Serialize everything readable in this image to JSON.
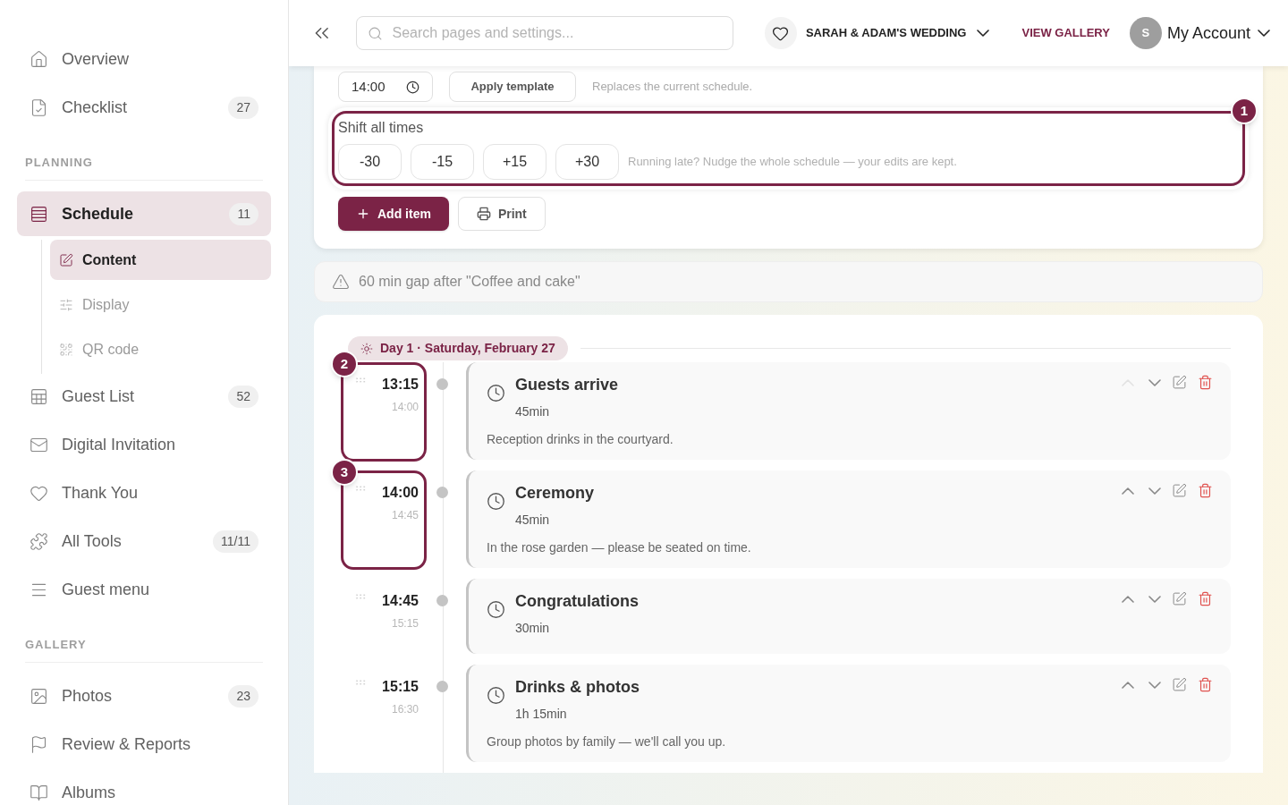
{
  "sidebar": {
    "entries": [
      {
        "kind": "item",
        "label": "Overview",
        "selected": false
      },
      {
        "kind": "item",
        "label": "Checklist",
        "count": "27",
        "selected": false
      },
      {
        "kind": "heading",
        "label": "PLANNING"
      },
      {
        "kind": "item",
        "label": "Schedule",
        "count": "11",
        "selected": true,
        "children": [
          {
            "label": "Content",
            "selected": true
          },
          {
            "label": "Display",
            "selected": false
          },
          {
            "label": "QR code",
            "selected": false
          }
        ]
      },
      {
        "kind": "item",
        "label": "Guest List",
        "count": "52",
        "selected": false
      },
      {
        "kind": "item",
        "label": "Digital Invitation",
        "selected": false
      },
      {
        "kind": "item",
        "label": "Thank You",
        "selected": false
      },
      {
        "kind": "item",
        "label": "All Tools",
        "count": "11/11",
        "selected": false
      },
      {
        "kind": "item",
        "label": "Guest menu",
        "selected": false
      },
      {
        "kind": "heading",
        "label": "GALLERY"
      },
      {
        "kind": "item",
        "label": "Photos",
        "count": "23",
        "selected": false
      },
      {
        "kind": "item",
        "label": "Review & Reports",
        "selected": false
      },
      {
        "kind": "item",
        "label": "Albums",
        "selected": false
      }
    ]
  },
  "header": {
    "search": {
      "placeholder": "Search pages and settings..."
    },
    "event": "SARAH & ADAM'S WEDDING",
    "gallery_link": "VIEW GALLERY",
    "avatar": "S",
    "account": "My Account"
  },
  "toolbar": {
    "start_time": "14:00",
    "template_button": "Apply template",
    "template_hint": "Replaces the current schedule.",
    "shift": {
      "title": "Shift all times",
      "callout": "1",
      "buttons": [
        "-30",
        "-15",
        "+15",
        "+30"
      ],
      "hint": "Running late? Nudge the whole schedule — your edits are kept."
    },
    "add_button": "Add item",
    "print_button": "Print"
  },
  "warning": "60 min gap after \"Coffee and cake\"",
  "day": {
    "label": "Day 1 · Saturday, February 27"
  },
  "items": [
    {
      "time": "13:15",
      "end": "14:00",
      "title": "Guests arrive",
      "duration": "45min",
      "note": "Reception drinks in the courtyard.",
      "up_disabled": true,
      "callout": "2"
    },
    {
      "time": "14:00",
      "end": "14:45",
      "title": "Ceremony",
      "duration": "45min",
      "note": "In the rose garden — please be seated on time.",
      "up_disabled": false,
      "callout": "3"
    },
    {
      "time": "14:45",
      "end": "15:15",
      "title": "Congratulations",
      "duration": "30min",
      "up_disabled": false
    },
    {
      "time": "15:15",
      "end": "16:30",
      "title": "Drinks & photos",
      "duration": "1h 15min",
      "note": "Group photos by family — we'll call you up.",
      "up_disabled": false
    }
  ]
}
